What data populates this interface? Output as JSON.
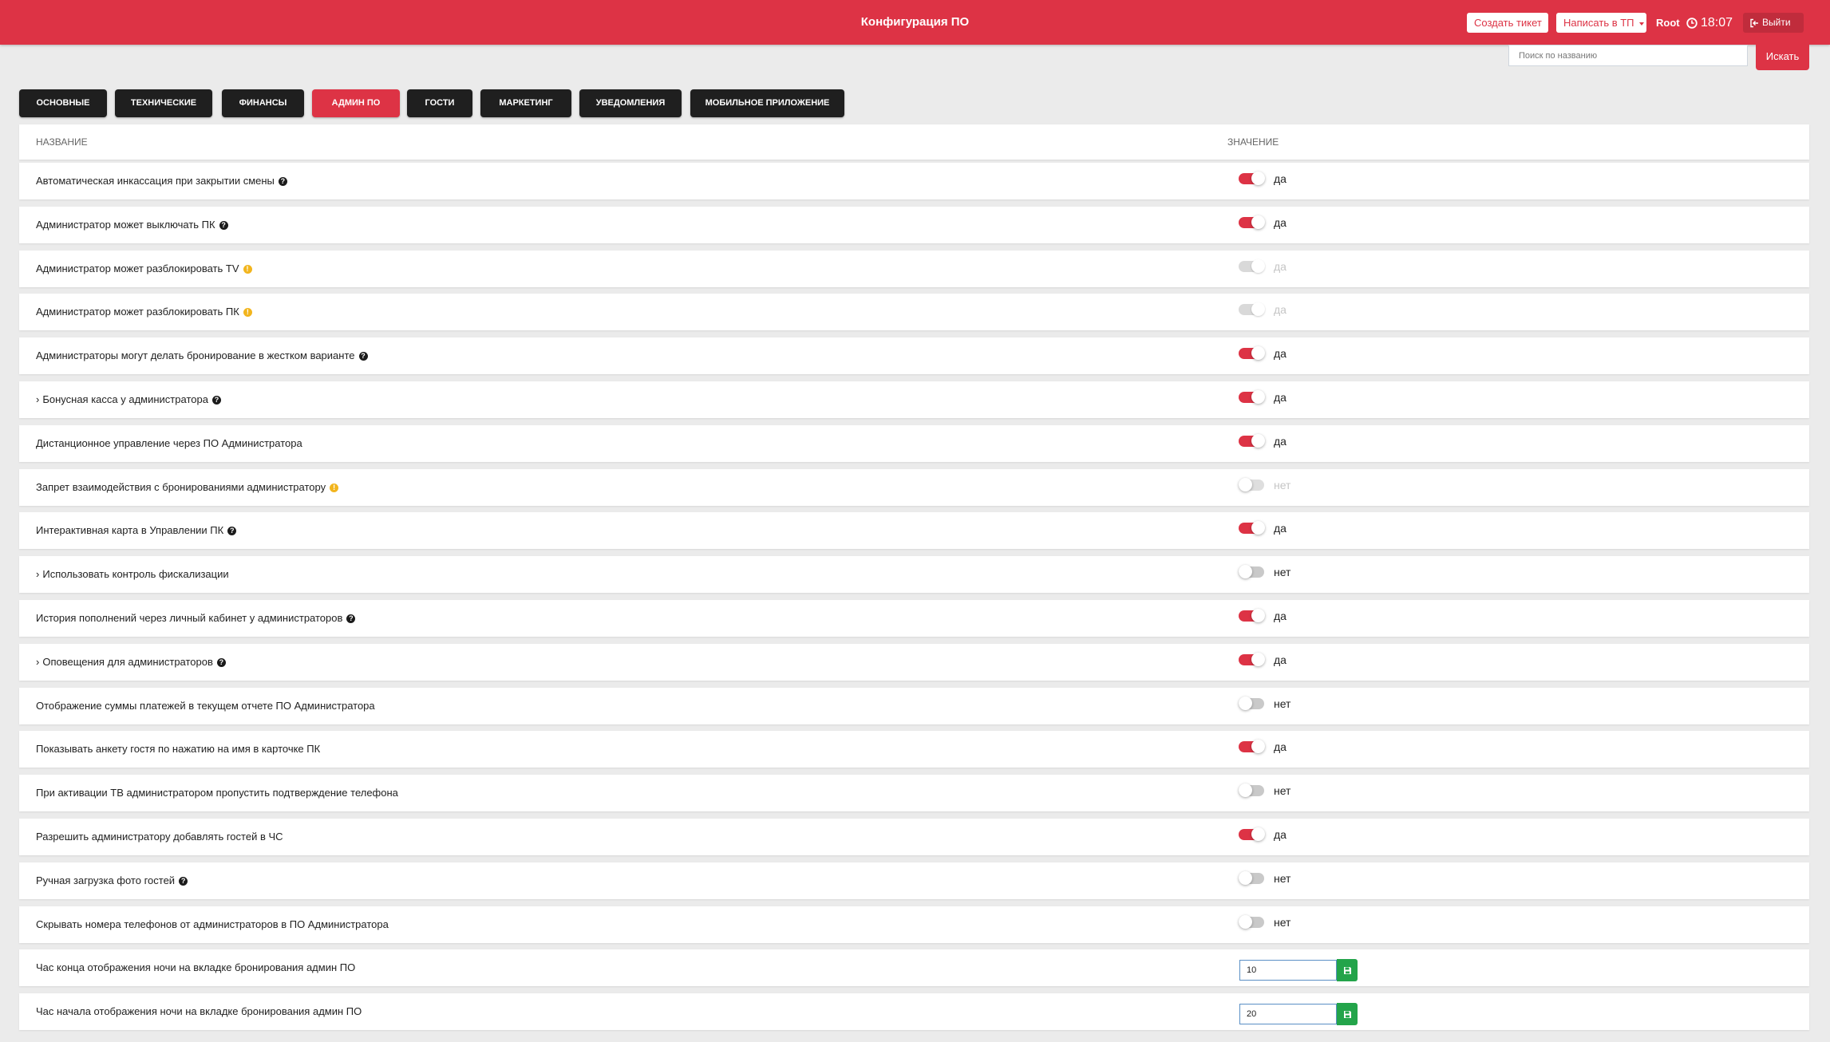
{
  "header": {
    "title": "Конфигурация ПО",
    "create_ticket": "Создать тикет",
    "write_support": "Написать в ТП",
    "user": "Root",
    "time": "18:07",
    "logout": "Выйти"
  },
  "search": {
    "placeholder": "Поиск по названию",
    "button": "Искать"
  },
  "tabs": [
    {
      "label": "Основные",
      "active": false
    },
    {
      "label": "Технические",
      "active": false
    },
    {
      "label": "Финансы",
      "active": false
    },
    {
      "label": "Админ ПО",
      "active": true
    },
    {
      "label": "Гости",
      "active": false
    },
    {
      "label": "Маркетинг",
      "active": false
    },
    {
      "label": "Уведомления",
      "active": false
    },
    {
      "label": "Мобильное приложение",
      "active": false
    }
  ],
  "table": {
    "col_name": "Название",
    "col_value": "Значение",
    "rows": [
      {
        "name": "Автоматическая инкассация при закрытии смены",
        "icon": "help",
        "on": true,
        "disabled": false,
        "value": "да"
      },
      {
        "name": "Администратор может выключать ПК",
        "icon": "help",
        "on": true,
        "disabled": false,
        "value": "да"
      },
      {
        "name": "Администратор может разблокировать TV",
        "icon": "warning",
        "on": true,
        "disabled": true,
        "value": "да"
      },
      {
        "name": "Администратор может разблокировать ПК",
        "icon": "warning",
        "on": true,
        "disabled": true,
        "value": "да"
      },
      {
        "name": "Администраторы могут делать бронирование в жестком варианте",
        "icon": "help",
        "on": true,
        "disabled": false,
        "value": "да"
      },
      {
        "name": "Бонусная касса у администратора",
        "icon": "help",
        "expand": true,
        "on": true,
        "disabled": false,
        "value": "да"
      },
      {
        "name": "Дистанционное управление через ПО Администратора",
        "icon": "",
        "on": true,
        "disabled": false,
        "value": "да"
      },
      {
        "name": "Запрет взаимодействия с бронированиями администратору",
        "icon": "warning",
        "on": false,
        "disabled": true,
        "value": "нет"
      },
      {
        "name": "Интерактивная карта в Управлении ПК",
        "icon": "help",
        "on": true,
        "disabled": false,
        "value": "да"
      },
      {
        "name": "Использовать контроль фискализации",
        "icon": "",
        "expand": true,
        "on": false,
        "disabled": false,
        "value": "нет"
      },
      {
        "name": "История пополнений через личный кабинет у администраторов",
        "icon": "help",
        "on": true,
        "disabled": false,
        "value": "да"
      },
      {
        "name": "Оповещения для администраторов",
        "icon": "help",
        "expand": true,
        "on": true,
        "disabled": false,
        "value": "да"
      },
      {
        "name": "Отображение суммы платежей в текущем отчете ПО Администратора",
        "icon": "",
        "on": false,
        "disabled": false,
        "value": "нет"
      },
      {
        "name": "Показывать анкету гостя по нажатию на имя в карточке ПК",
        "icon": "",
        "on": true,
        "disabled": false,
        "value": "да"
      },
      {
        "name": "При активации ТВ администратором пропустить подтверждение телефона",
        "icon": "",
        "on": false,
        "disabled": false,
        "value": "нет"
      },
      {
        "name": "Разрешить администратору добавлять гостей в ЧС",
        "icon": "",
        "on": true,
        "disabled": false,
        "value": "да"
      },
      {
        "name": "Ручная загрузка фото гостей",
        "icon": "help",
        "on": false,
        "disabled": false,
        "value": "нет"
      },
      {
        "name": "Скрывать номера телефонов от администраторов в ПО Администратора",
        "icon": "",
        "on": false,
        "disabled": false,
        "value": "нет"
      },
      {
        "name": "Час конца отображения ночи на вкладке бронирования админ ПО",
        "icon": "",
        "input": "10"
      },
      {
        "name": "Час начала отображения ночи на вкладке бронирования админ ПО",
        "icon": "",
        "input": "20"
      }
    ]
  },
  "colors": {
    "accent": "#dd3345",
    "tab_dark": "#1f1f1f",
    "save_green": "#23a44a",
    "background": "#ebebeb"
  }
}
